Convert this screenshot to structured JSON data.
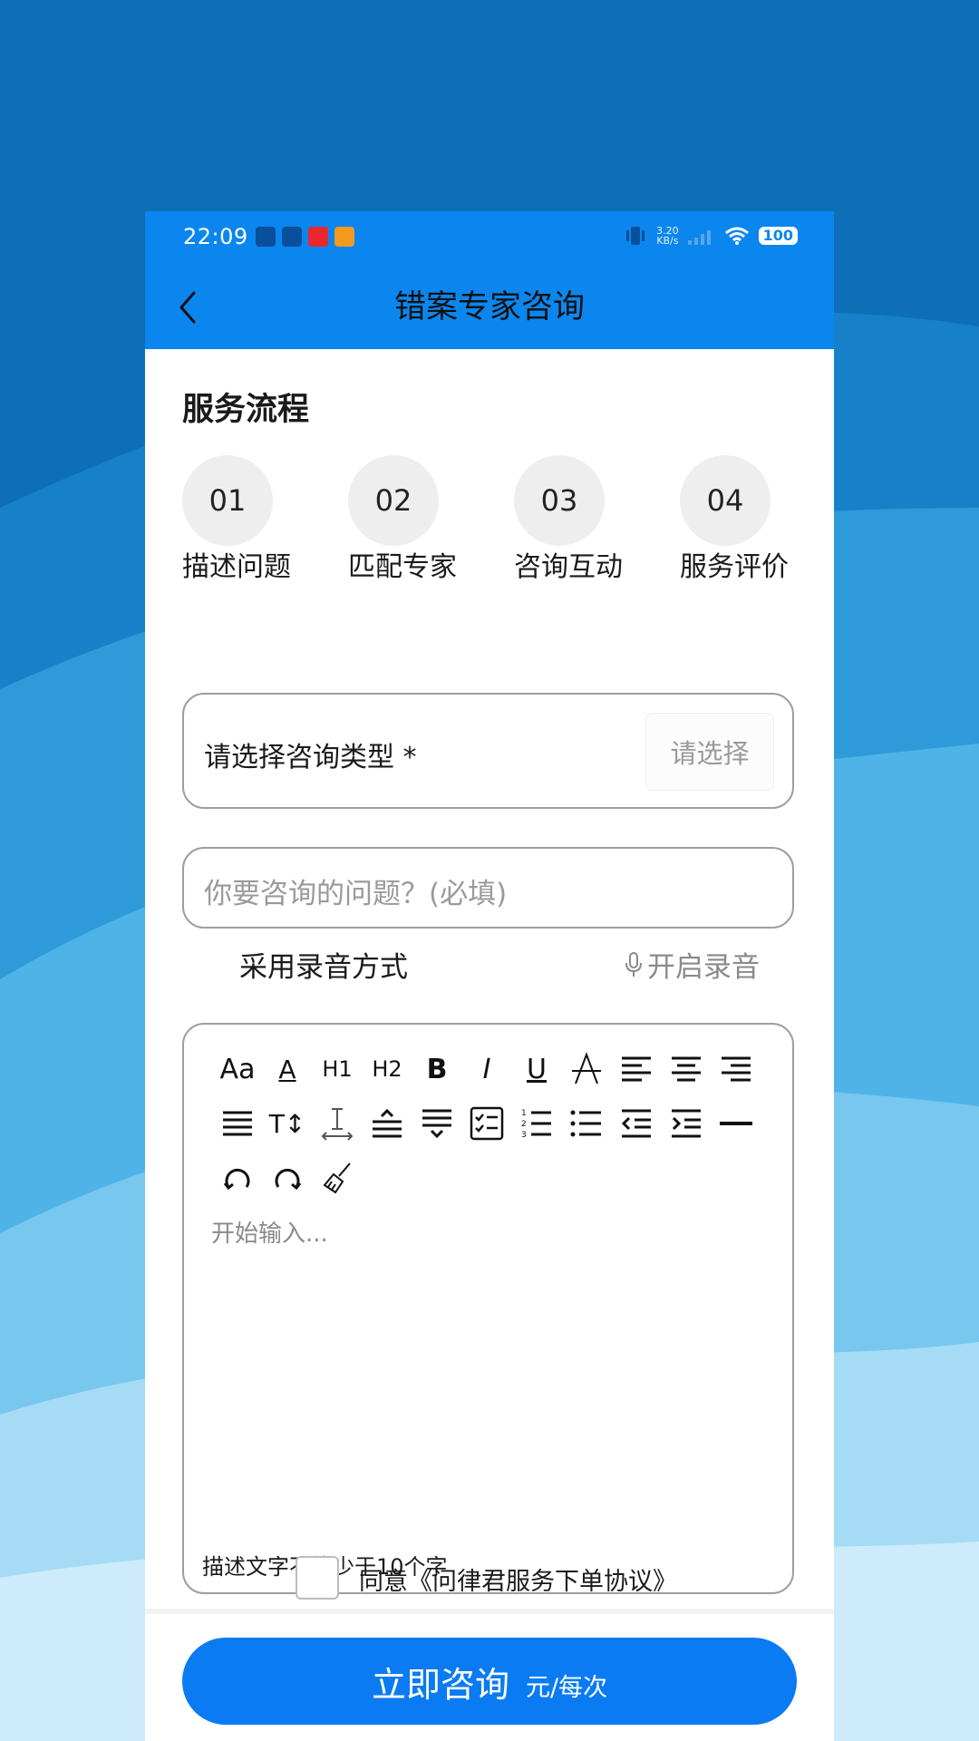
{
  "status_bar": {
    "time": "22:09",
    "net_speed_value": "3.20",
    "net_speed_unit": "KB/s",
    "battery": "100",
    "apps": [
      "clipboard-icon",
      "mail-icon",
      "app-red-icon",
      "app-orange-icon"
    ]
  },
  "navbar": {
    "title": "错案专家咨询",
    "back_icon": "chevron-left-icon"
  },
  "service_flow": {
    "title": "服务流程",
    "steps": [
      {
        "num": "01",
        "label": "描述问题"
      },
      {
        "num": "02",
        "label": "匹配专家"
      },
      {
        "num": "03",
        "label": "咨询互动"
      },
      {
        "num": "04",
        "label": "服务评价"
      }
    ]
  },
  "consult_type": {
    "label": "请选择咨询类型 *",
    "button": "请选择"
  },
  "question": {
    "placeholder": "你要咨询的问题？(必填)"
  },
  "voice": {
    "label": "采用录音方式",
    "button": "开启录音",
    "icon": "microphone-icon"
  },
  "editor": {
    "toolbar": [
      "font-size-icon",
      "font-color-icon",
      "heading1-icon",
      "heading2-icon",
      "bold-icon",
      "italic-icon",
      "underline-icon",
      "strikethrough-icon",
      "align-left-icon",
      "align-center-icon",
      "align-right-icon",
      "justify-icon",
      "text-size-icon",
      "line-height-icon",
      "paragraph-spacing-above-icon",
      "paragraph-spacing-below-icon",
      "checklist-icon",
      "ordered-list-icon",
      "bullet-list-icon",
      "outdent-icon",
      "indent-icon",
      "horizontal-rule-icon",
      "undo-icon",
      "redo-icon",
      "clear-format-icon"
    ],
    "toolbar_text": {
      "font_size": "Aa",
      "font_color": "A",
      "h1": "H1",
      "h2": "H2",
      "bold": "B",
      "italic": "I",
      "underline": "U",
      "text_size": "T↕"
    },
    "placeholder": "开始输入...",
    "hint": "描述文字不能少于10个字"
  },
  "agreement": {
    "prefix": "同意",
    "link": "《问律君服务下单协议》"
  },
  "submit": {
    "label": "立即咨询",
    "unit": "元/每次"
  },
  "colors": {
    "header": "#0b86ee",
    "button": "#0a7bf2"
  }
}
